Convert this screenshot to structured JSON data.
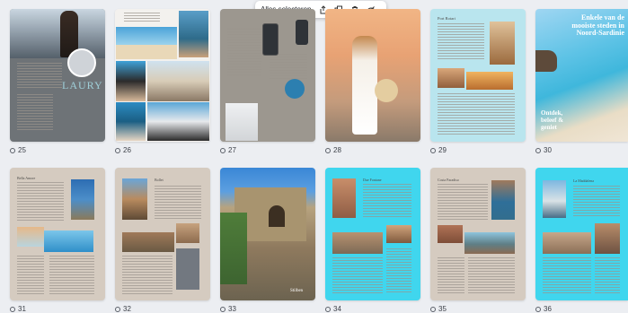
{
  "toolbar": {
    "select_all_label": "Alles selecteren",
    "icons": [
      "share-icon",
      "duplicate-icon",
      "delete-icon",
      "hide-icon"
    ]
  },
  "pages": [
    {
      "number": "25",
      "cover_text": "LAURY"
    },
    {
      "number": "26"
    },
    {
      "number": "27"
    },
    {
      "number": "28"
    },
    {
      "number": "29",
      "title": "Port Rotari"
    },
    {
      "number": "30",
      "title": "Enkele van de mooiste steden in Noord-Sardinie",
      "subtitle": "Ontdek, beleef & geniet"
    },
    {
      "number": "31",
      "title": "Bella Amore"
    },
    {
      "number": "32",
      "title": "Bollet"
    },
    {
      "number": "33",
      "caption": "Stilben"
    },
    {
      "number": "34",
      "title": "Due Fontane"
    },
    {
      "number": "35",
      "title": "Costa Paradiso"
    },
    {
      "number": "36",
      "title": "La Maddalena"
    }
  ],
  "colors": {
    "background": "#eceef2",
    "beige": "#d5cbc0",
    "cyan": "#40d6ee",
    "slate": "#6e7377"
  }
}
